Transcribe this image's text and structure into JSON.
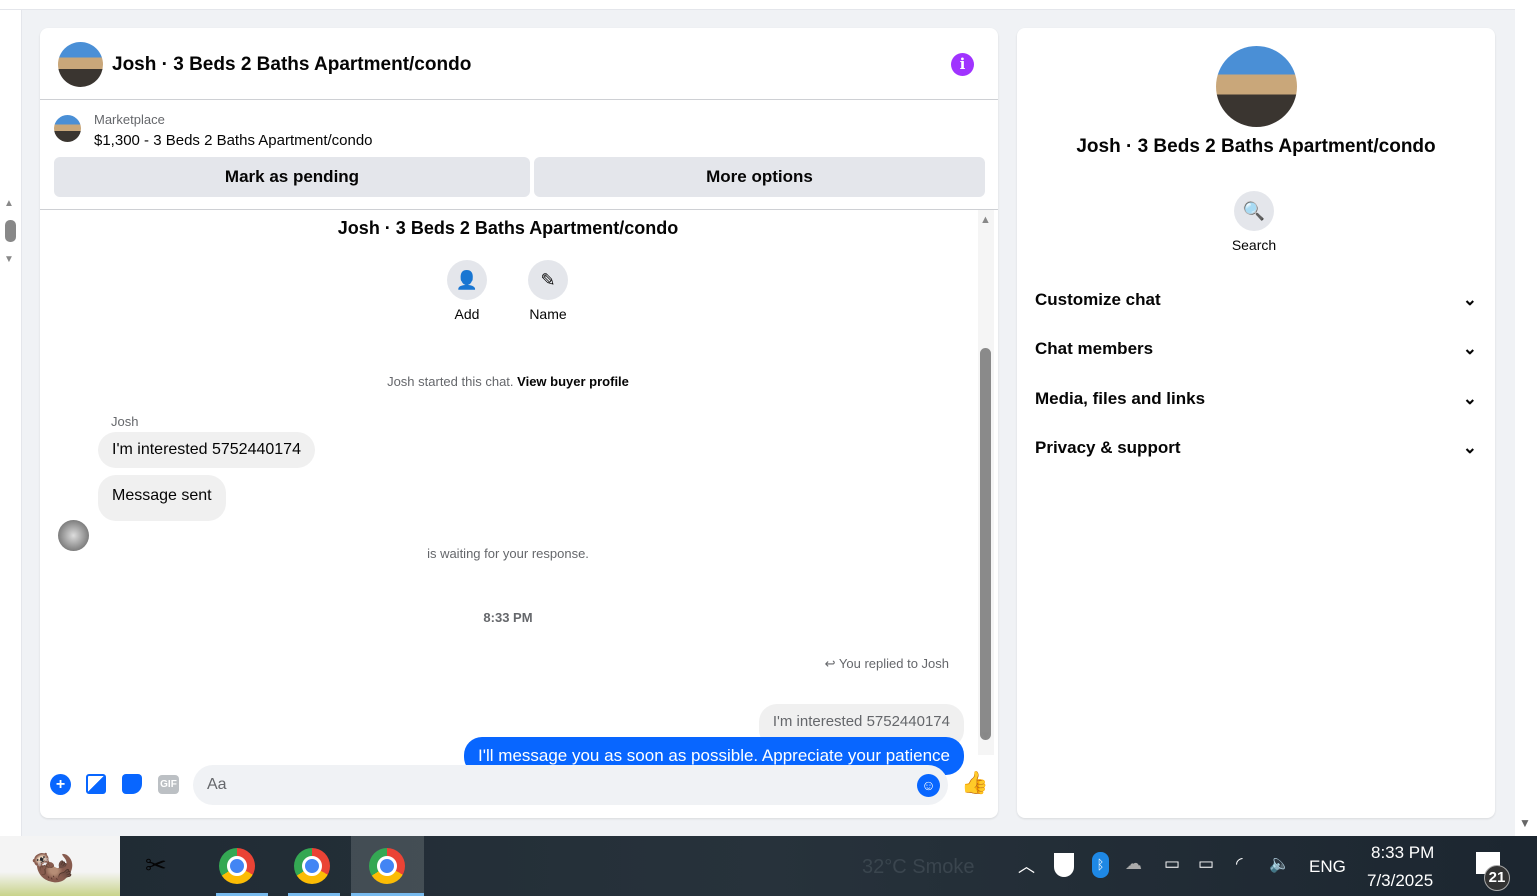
{
  "chat": {
    "title": "Josh · 3 Beds 2 Baths Apartment/condo",
    "marketplace_label": "Marketplace",
    "listing": "$1,300 - 3 Beds 2 Baths Apartment/condo",
    "mark_pending": "Mark as pending",
    "more_options": "More options",
    "intro_title": "Josh · 3 Beds 2 Baths Apartment/condo",
    "add_label": "Add",
    "name_label": "Name",
    "started": "Josh started this chat.",
    "view_profile": "View buyer profile",
    "sender": "Josh",
    "msg1": "I'm interested 5752440174",
    "msg2": "Message sent",
    "waiting": "is waiting for your response.",
    "time": "8:33 PM",
    "replied": "You replied to Josh",
    "quoted": "I'm interested 5752440174",
    "reply": "I'll message you as soon as possible. Appreciate your patience",
    "composer_placeholder": "Aa",
    "gif": "GIF"
  },
  "right": {
    "title": "Josh · 3 Beds 2 Baths Apartment/condo",
    "search_label": "Search",
    "sections": [
      "Customize chat",
      "Chat members",
      "Media, files and links",
      "Privacy & support"
    ]
  },
  "taskbar": {
    "weather": "32°C  Smoke",
    "lang": "ENG",
    "time": "8:33 PM",
    "date": "7/3/2025",
    "notifications": "21"
  },
  "colors": {
    "accent": "#0866ff",
    "info": "#a033ff"
  }
}
